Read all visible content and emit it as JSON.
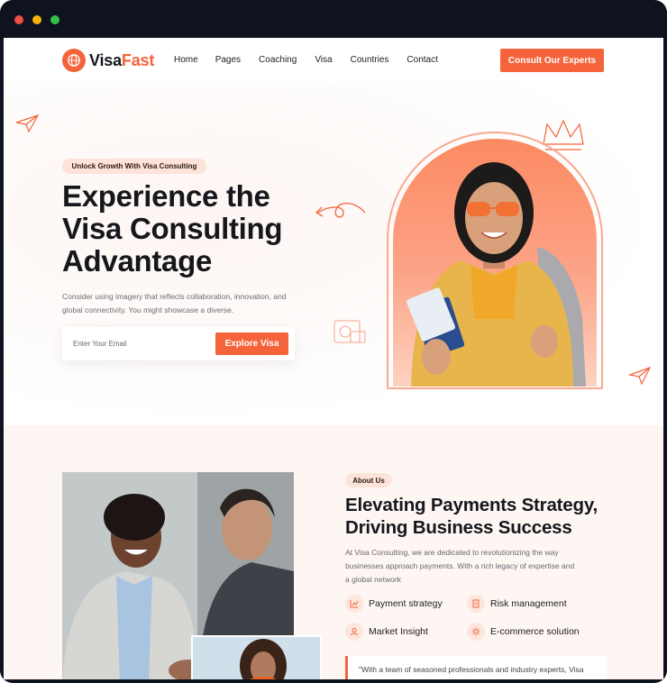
{
  "window": {
    "controls": [
      "close",
      "minimize",
      "maximize"
    ]
  },
  "brand": {
    "name_part1": "Visa",
    "name_part2": "Fast",
    "logo_icon": "globe-icon",
    "accent": "#f4633a",
    "dark": "#15171c"
  },
  "nav": {
    "items": [
      "Home",
      "Pages",
      "Coaching",
      "Visa",
      "Countries",
      "Contact"
    ],
    "cta_label": "Consult Our Experts"
  },
  "hero": {
    "tag": "Unlock Growth With Visa Consulting",
    "title_line1": "Experience the",
    "title_line2": "Visa Consulting",
    "title_line3": "Advantage",
    "description": "Consider using imagery that reflects collaboration, innovation, and global connectivity. You might showcase a diverse.",
    "email_placeholder": "Enter Your Email",
    "button_label": "Explore Visa"
  },
  "about": {
    "tag": "About Us",
    "title_line1": "Elevating Payments Strategy,",
    "title_line2": "Driving Business Success",
    "description": "At Visa Consulting, we are dedicated to revolutionizing the way businesses approach payments. With a rich legacy of expertise and a global network",
    "features": [
      {
        "label": "Payment strategy",
        "icon": "chart-icon"
      },
      {
        "label": "Risk management",
        "icon": "document-icon"
      },
      {
        "label": "Market Insight",
        "icon": "user-icon"
      },
      {
        "label": "E-commerce solution",
        "icon": "gear-icon"
      }
    ],
    "quote": "\"With a team of seasoned professionals and industry experts, Visa"
  }
}
